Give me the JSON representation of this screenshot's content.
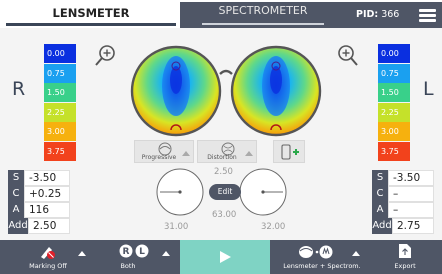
{
  "header": {
    "tab_lensmeter": "LENSMETER",
    "tab_spectrometer": "SPECTROMETER",
    "pid_label": "PID:",
    "pid_value": "366"
  },
  "sides": {
    "left_letter": "R",
    "right_letter": "L"
  },
  "scale_left": [
    {
      "value": "0.00",
      "color": "#0a2fe0"
    },
    {
      "value": "0.75",
      "color": "#1aa0f0"
    },
    {
      "value": "1.50",
      "color": "#39d08a"
    },
    {
      "value": "2.25",
      "color": "#c5e12a"
    },
    {
      "value": "3.00",
      "color": "#f6b10e"
    },
    {
      "value": "3.75",
      "color": "#f2421c"
    }
  ],
  "scale_right": [
    {
      "value": "0.00",
      "color": "#0a2fe0"
    },
    {
      "value": "0.75",
      "color": "#1aa0f0"
    },
    {
      "value": "1.50",
      "color": "#39d08a"
    },
    {
      "value": "2.25",
      "color": "#c5e12a"
    },
    {
      "value": "3.00",
      "color": "#f6b10e"
    },
    {
      "value": "3.75",
      "color": "#f2421c"
    }
  ],
  "modes": {
    "progressive": "Progressive",
    "distortion": "Distortion"
  },
  "right_lens": {
    "S": "-3.50",
    "C": "+0.25",
    "A": "116",
    "Add": "2.50"
  },
  "left_lens": {
    "S": "-3.50",
    "C": "–",
    "A": "–",
    "Add": "2.75"
  },
  "keys": {
    "s": "S",
    "c": "C",
    "a": "A",
    "add": "Add"
  },
  "center": {
    "top_value": "2.50",
    "bottom_value": "63.00",
    "left_axis": "31.00",
    "right_axis": "32.00",
    "edit_label": "Edit"
  },
  "bottom": {
    "marking": "Marking Off",
    "both": "Both",
    "both_r": "R",
    "both_l": "L",
    "lensmeter_spectrom": "Lensmeter + Spectrom.",
    "export": "Export"
  },
  "colors": {
    "accent": "#4f5666",
    "play": "#7fd3c4"
  }
}
